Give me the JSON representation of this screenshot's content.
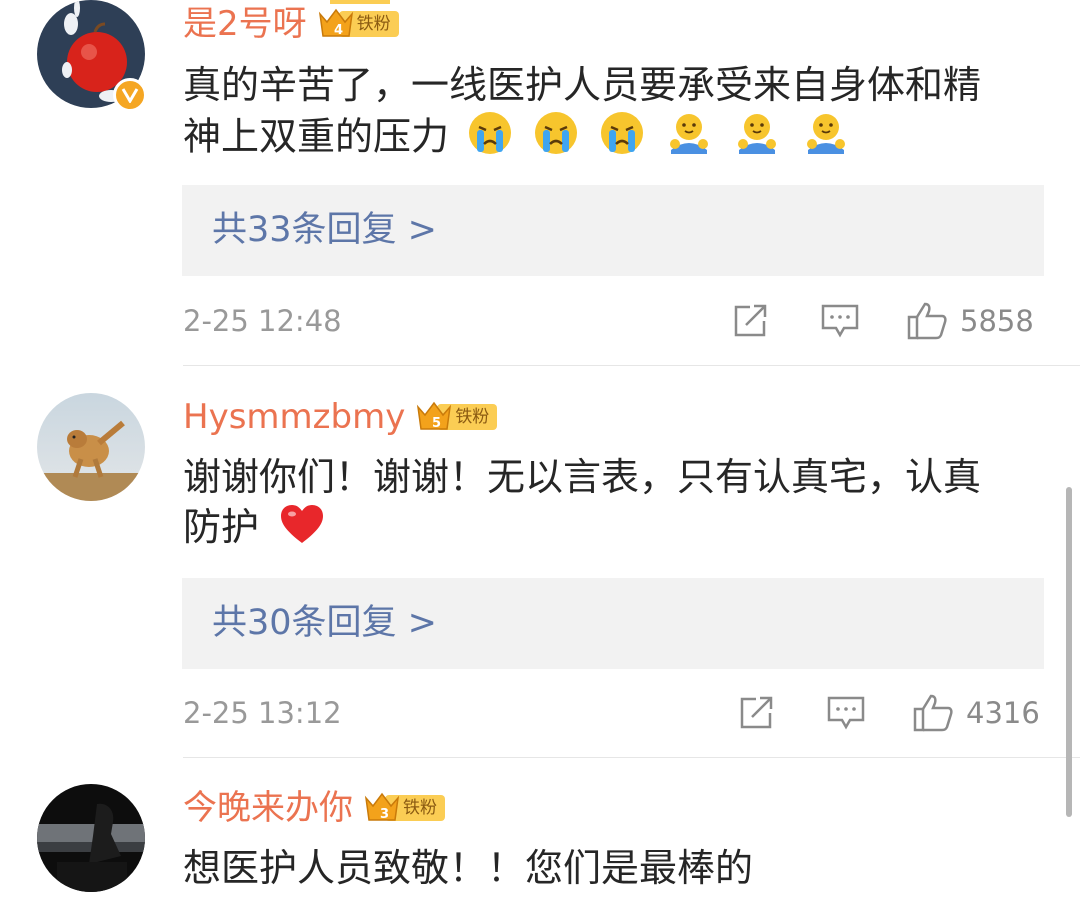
{
  "comments": [
    {
      "username": "是2号呀",
      "fan_badge": "铁粉",
      "fan_level": "4",
      "verified": true,
      "text_line1": "真的辛苦了，一线医护人员要承受来自身体和精",
      "text_line2": "神上双重的压力",
      "emojis": [
        "crying-face",
        "crying-face",
        "crying-face",
        "hug-face",
        "hug-face",
        "hug-face"
      ],
      "replies_label": "共33条回复 >",
      "timestamp": "2-25 12:48",
      "likes": "5858"
    },
    {
      "username": "Hysmmzbmy",
      "fan_badge": "铁粉",
      "fan_level": "5",
      "verified": false,
      "text_line1": "谢谢你们！谢谢！无以言表，只有认真宅，认真",
      "text_line2": "防护",
      "emojis": [
        "red-heart"
      ],
      "replies_label": "共30条回复 >",
      "timestamp": "2-25 13:12",
      "likes": "4316"
    },
    {
      "username": "今晚来办你",
      "fan_badge": "铁粉",
      "fan_level": "3",
      "verified": false,
      "text_line1": "想医护人员致敬！！您们是最棒的"
    }
  ],
  "colors": {
    "username": "#eb7350",
    "reply_link": "#5d76a8",
    "meta": "#999999",
    "badge": "#fbcd54",
    "verified": "#f5a623"
  }
}
